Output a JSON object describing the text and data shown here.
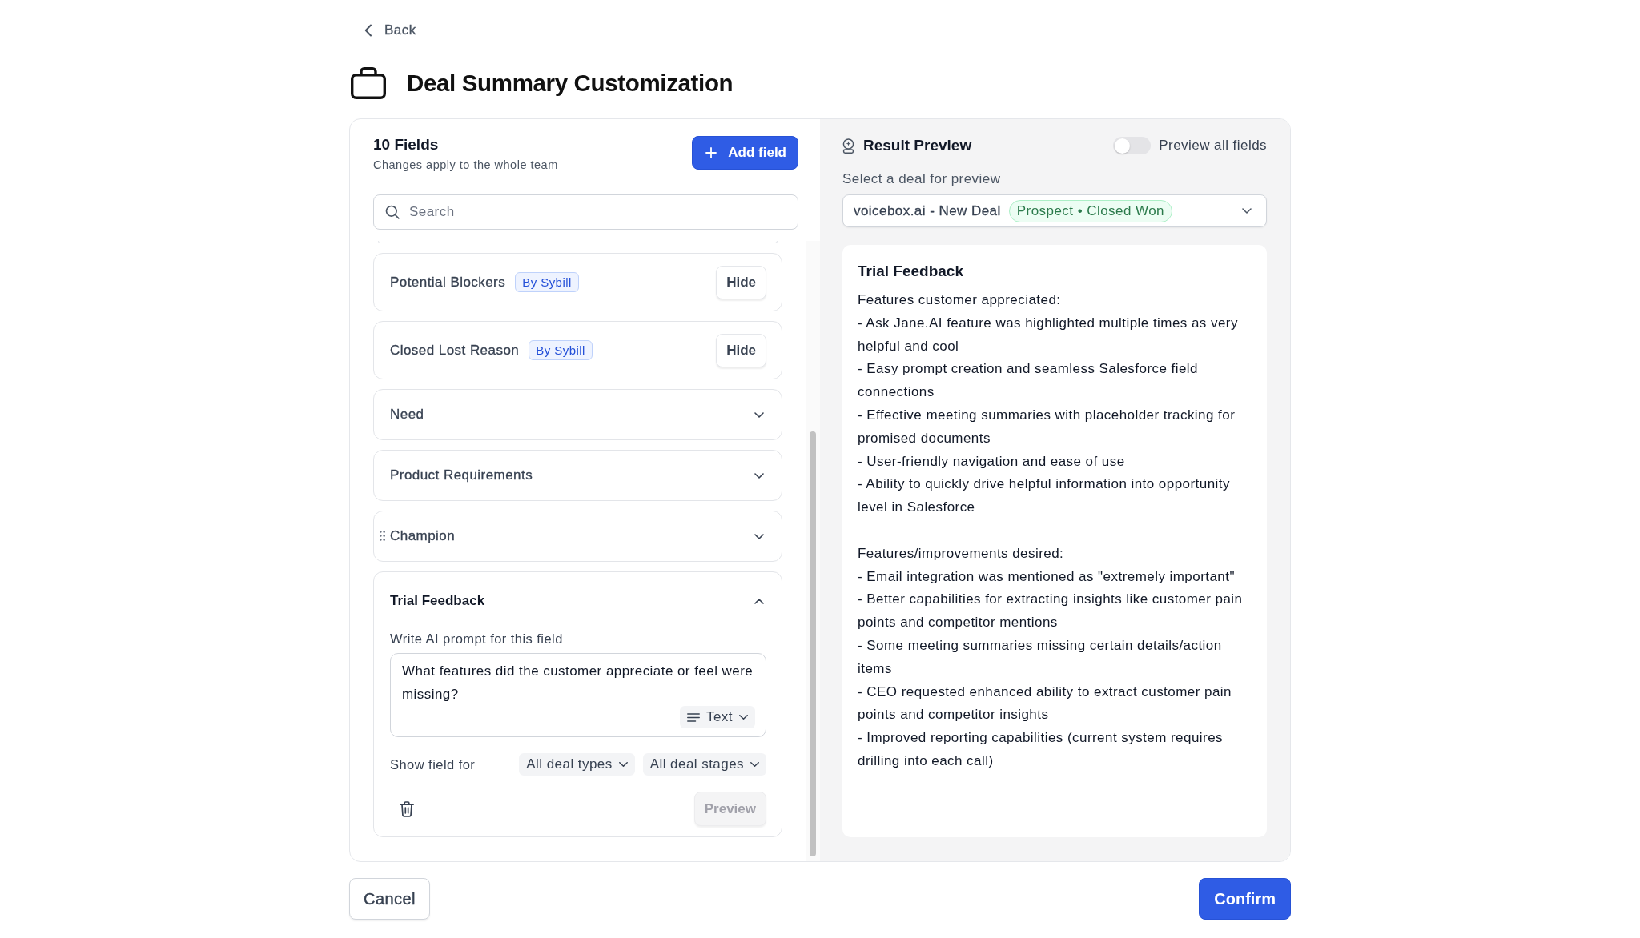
{
  "header": {
    "back": "Back",
    "title": "Deal Summary Customization"
  },
  "fields_panel": {
    "count_title": "10 Fields",
    "subtitle": "Changes apply to the whole team",
    "add_button": "Add field",
    "search": {
      "placeholder": "Search"
    },
    "fields": [
      {
        "kind": "builtin",
        "name": "Potential Blockers",
        "badge": "By Sybill",
        "action": "Hide",
        "hovered": false
      },
      {
        "kind": "builtin",
        "name": "Closed Lost Reason",
        "badge": "By Sybill",
        "action": "Hide",
        "hovered": false
      },
      {
        "kind": "custom",
        "name": "Need",
        "expanded": false,
        "hovered": false
      },
      {
        "kind": "custom",
        "name": "Product Requirements",
        "expanded": false,
        "hovered": false
      },
      {
        "kind": "custom",
        "name": "Champion",
        "expanded": false,
        "hovered": true
      },
      {
        "kind": "custom",
        "name": "Trial Feedback",
        "expanded": true,
        "hovered": false,
        "editor": {
          "prompt_label": "Write AI prompt for this field",
          "prompt": "What features did the customer appreciate or feel were missing?",
          "format": "Text",
          "show_label": "Show field for",
          "deal_types": "All deal types",
          "deal_stages": "All deal stages",
          "preview_button": {
            "label": "Preview",
            "disabled": true
          }
        }
      }
    ]
  },
  "preview_panel": {
    "title": "Result Preview",
    "toggle": {
      "label": "Preview all fields",
      "on": false
    },
    "deal_label": "Select a deal for preview",
    "deal": {
      "name": "voicebox.ai - New Deal",
      "status": "Prospect • Closed Won"
    },
    "result": {
      "title": "Trial Feedback",
      "sections": [
        {
          "heading": "Features customer appreciated:",
          "items": [
            "- Ask Jane.AI feature was highlighted multiple times as very helpful and cool",
            "- Easy prompt creation and seamless Salesforce field connections",
            "- Effective meeting summaries with placeholder tracking for promised documents",
            "- User-friendly navigation and ease of use",
            "- Ability to quickly drive helpful information into opportunity level in Salesforce"
          ]
        },
        {
          "heading": "Features/improvements desired:",
          "items": [
            "- Email integration was mentioned as \"extremely important\"",
            "- Better capabilities for extracting insights like customer pain points and competitor mentions",
            "- Some meeting summaries missing certain details/action items",
            "- CEO requested enhanced ability to extract customer pain points and competitor insights",
            "- Improved reporting capabilities (current system requires drilling into each call)"
          ]
        }
      ]
    }
  },
  "footer": {
    "cancel": "Cancel",
    "confirm": "Confirm"
  }
}
